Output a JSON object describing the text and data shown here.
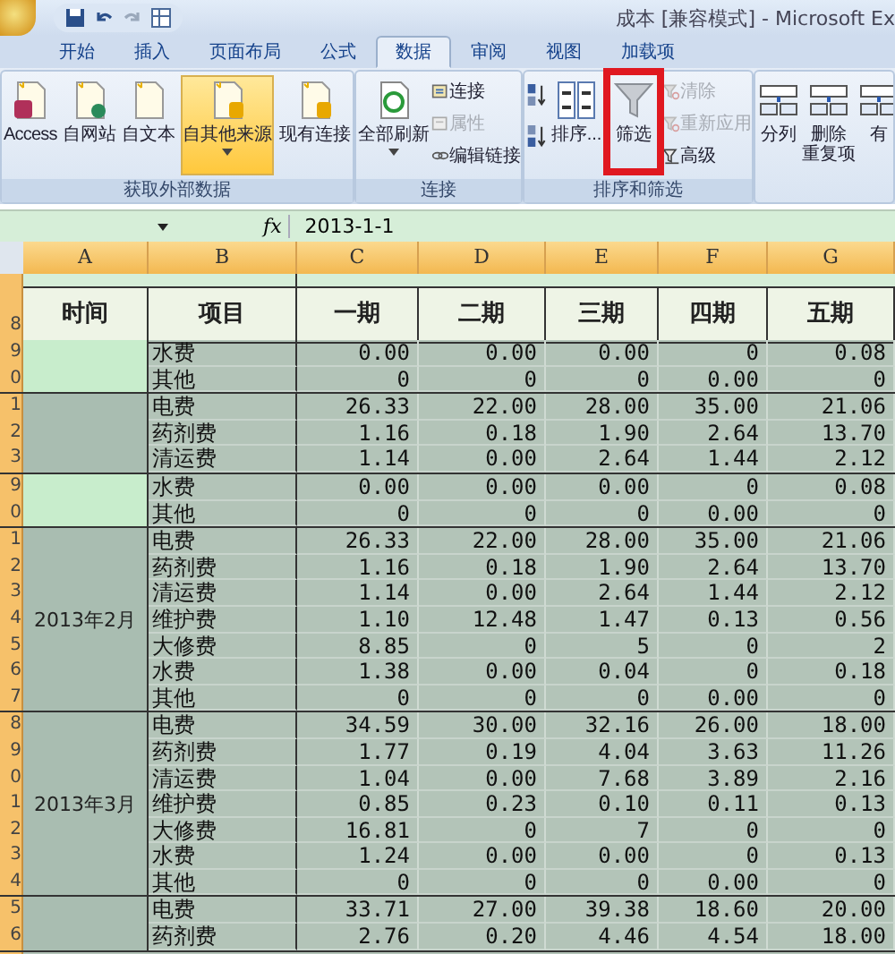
{
  "title_bar": {
    "title": "成本  [兼容模式] - Microsoft Ex"
  },
  "ribbon_tabs": [
    {
      "label": "开始",
      "selected": false
    },
    {
      "label": "插入",
      "selected": false
    },
    {
      "label": "页面布局",
      "selected": false
    },
    {
      "label": "公式",
      "selected": false
    },
    {
      "label": "数据",
      "selected": true
    },
    {
      "label": "审阅",
      "selected": false
    },
    {
      "label": "视图",
      "selected": false
    },
    {
      "label": "加载项",
      "selected": false
    }
  ],
  "ribbon_groups": [
    {
      "label": "获取外部数据",
      "buttons": [
        {
          "kind": "large",
          "label": "Access",
          "selected": false
        },
        {
          "kind": "large",
          "label": "自网站",
          "selected": false
        },
        {
          "kind": "large",
          "label": "自文本",
          "selected": false
        },
        {
          "kind": "large",
          "label": "自其他来源",
          "selected": true,
          "dropdown": true
        },
        {
          "kind": "large",
          "label": "现有连接",
          "selected": false
        }
      ]
    },
    {
      "label": "连接",
      "buttons": [
        {
          "kind": "large",
          "label": "全部刷新",
          "selected": false,
          "dropdown": true
        },
        {
          "kind": "small",
          "label": "连接",
          "disabled": false
        },
        {
          "kind": "small",
          "label": "属性",
          "disabled": true
        },
        {
          "kind": "small",
          "label": "编辑链接",
          "disabled": false
        }
      ]
    },
    {
      "label": "排序和筛选",
      "buttons": [
        {
          "kind": "icon"
        },
        {
          "kind": "large",
          "label": "排序...",
          "selected": false
        },
        {
          "kind": "large",
          "label": "筛选",
          "selected": false,
          "highlighted": true
        },
        {
          "kind": "small",
          "label": "清除",
          "disabled": true
        },
        {
          "kind": "small",
          "label": "重新应用",
          "disabled": true
        },
        {
          "kind": "small",
          "label": "高级",
          "disabled": false
        }
      ]
    },
    {
      "buttons": [
        {
          "kind": "large",
          "label": "分列",
          "selected": false
        },
        {
          "kind": "large",
          "lines": [
            "删除",
            "重复项"
          ],
          "selected": false
        },
        {
          "kind": "large",
          "label": "有",
          "selected": false
        }
      ]
    }
  ],
  "formula_bar": {
    "function_label": "fx",
    "value": "2013-1-1"
  },
  "columns": [
    "A",
    "B",
    "C",
    "D",
    "E",
    "F",
    "G"
  ],
  "header_row": {
    "row_number": "8",
    "cells": [
      "时间",
      "项目",
      "一期",
      "二期",
      "三期",
      "四期",
      "五期"
    ]
  },
  "groups": [
    {
      "color": "#c8edcc",
      "rows": [
        {
          "row_number": "9",
          "item": "水费",
          "values": [
            "0.00",
            "0.00",
            "0.00",
            "0",
            "0.08"
          ]
        },
        {
          "row_number": "0",
          "item": "其他",
          "values": [
            "0",
            "0",
            "0",
            "0.00",
            "0"
          ]
        }
      ]
    },
    {
      "color": "#a9bdb1",
      "rows": [
        {
          "row_number": "1",
          "item": "电费",
          "values": [
            "26.33",
            "22.00",
            "28.00",
            "35.00",
            "21.06"
          ]
        },
        {
          "row_number": "2",
          "item": "药剂费",
          "values": [
            "1.16",
            "0.18",
            "1.90",
            "2.64",
            "13.70"
          ]
        },
        {
          "row_number": "3",
          "item": "清运费",
          "values": [
            "1.14",
            "0.00",
            "2.64",
            "1.44",
            "2.12"
          ]
        }
      ]
    },
    {
      "color": "#c8edcc",
      "rows": [
        {
          "row_number": "9",
          "item": "水费",
          "values": [
            "0.00",
            "0.00",
            "0.00",
            "0",
            "0.08"
          ]
        },
        {
          "row_number": "0",
          "item": "其他",
          "values": [
            "0",
            "0",
            "0",
            "0.00",
            "0"
          ]
        }
      ]
    },
    {
      "period": "2013年2月",
      "color": "#a9bdb1",
      "rows": [
        {
          "row_number": "1",
          "item": "电费",
          "values": [
            "26.33",
            "22.00",
            "28.00",
            "35.00",
            "21.06"
          ]
        },
        {
          "row_number": "2",
          "item": "药剂费",
          "values": [
            "1.16",
            "0.18",
            "1.90",
            "2.64",
            "13.70"
          ]
        },
        {
          "row_number": "3",
          "item": "清运费",
          "values": [
            "1.14",
            "0.00",
            "2.64",
            "1.44",
            "2.12"
          ]
        },
        {
          "row_number": "4",
          "item": "维护费",
          "values": [
            "1.10",
            "12.48",
            "1.47",
            "0.13",
            "0.56"
          ]
        },
        {
          "row_number": "5",
          "item": "大修费",
          "values": [
            "8.85",
            "0",
            "5",
            "0",
            "2"
          ]
        },
        {
          "row_number": "6",
          "item": "水费",
          "values": [
            "1.38",
            "0.00",
            "0.04",
            "0",
            "0.18"
          ]
        },
        {
          "row_number": "7",
          "item": "其他",
          "values": [
            "0",
            "0",
            "0",
            "0.00",
            "0"
          ]
        }
      ]
    },
    {
      "period": "2013年3月",
      "color": "#a9bdb1",
      "rows": [
        {
          "row_number": "8",
          "item": "电费",
          "values": [
            "34.59",
            "30.00",
            "32.16",
            "26.00",
            "18.00"
          ]
        },
        {
          "row_number": "9",
          "item": "药剂费",
          "values": [
            "1.77",
            "0.19",
            "4.04",
            "3.63",
            "11.26"
          ]
        },
        {
          "row_number": "0",
          "item": "清运费",
          "values": [
            "1.04",
            "0.00",
            "7.68",
            "3.89",
            "2.16"
          ]
        },
        {
          "row_number": "1",
          "item": "维护费",
          "values": [
            "0.85",
            "0.23",
            "0.10",
            "0.11",
            "0.13"
          ]
        },
        {
          "row_number": "2",
          "item": "大修费",
          "values": [
            "16.81",
            "0",
            "7",
            "0",
            "0"
          ]
        },
        {
          "row_number": "3",
          "item": "水费",
          "values": [
            "1.24",
            "0.00",
            "0.00",
            "0",
            "0.13"
          ]
        },
        {
          "row_number": "4",
          "item": "其他",
          "values": [
            "0",
            "0",
            "0",
            "0.00",
            "0"
          ]
        }
      ]
    },
    {
      "color": "#a9bdb1",
      "rows": [
        {
          "row_number": "5",
          "item": "电费",
          "values": [
            "33.71",
            "27.00",
            "39.38",
            "18.60",
            "20.00"
          ]
        },
        {
          "row_number": "6",
          "item": "药剂费",
          "values": [
            "2.76",
            "0.20",
            "4.46",
            "4.54",
            "18.00"
          ]
        }
      ]
    }
  ]
}
